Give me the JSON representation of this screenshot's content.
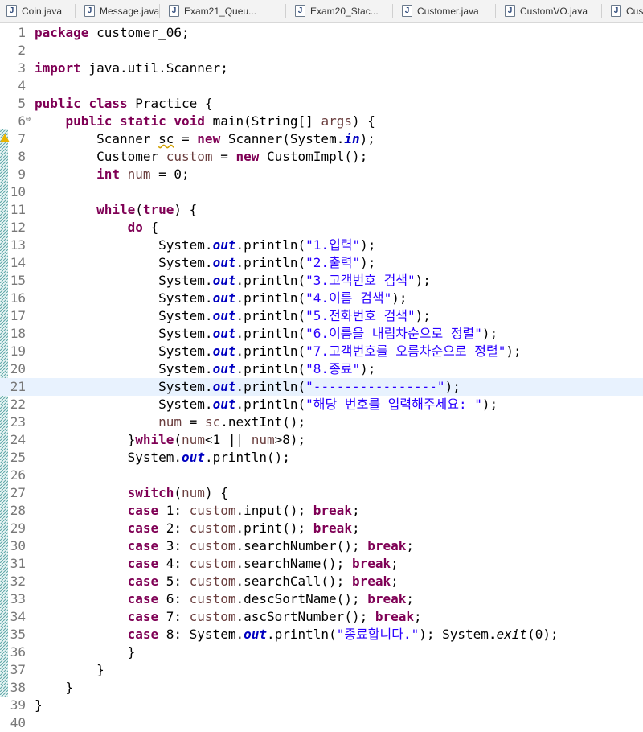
{
  "tabs": [
    "Coin.java",
    "Message.java",
    "Exam21_Queu...",
    "Exam20_Stac...",
    "Customer.java",
    "CustomVO.java",
    "Cust"
  ],
  "line_numbers": [
    "1",
    "2",
    "3",
    "4",
    "5",
    "6",
    "7",
    "8",
    "9",
    "10",
    "11",
    "12",
    "13",
    "14",
    "15",
    "16",
    "17",
    "18",
    "19",
    "20",
    "21",
    "22",
    "23",
    "24",
    "25",
    "26",
    "27",
    "28",
    "29",
    "30",
    "31",
    "32",
    "33",
    "34",
    "35",
    "36",
    "37",
    "38",
    "39",
    "40"
  ],
  "fold_marker": "⊖",
  "highlighted_line": 21,
  "code": [
    [
      [
        "kw",
        "package"
      ],
      [
        "p",
        " customer_06;"
      ]
    ],
    [],
    [
      [
        "kw",
        "import"
      ],
      [
        "p",
        " java.util.Scanner;"
      ]
    ],
    [],
    [
      [
        "kw",
        "public"
      ],
      [
        "p",
        " "
      ],
      [
        "kw",
        "class"
      ],
      [
        "p",
        " Practice {"
      ]
    ],
    [
      [
        "p",
        "    "
      ],
      [
        "kw",
        "public"
      ],
      [
        "p",
        " "
      ],
      [
        "kw",
        "static"
      ],
      [
        "p",
        " "
      ],
      [
        "kw",
        "void"
      ],
      [
        "p",
        " main(String[] "
      ],
      [
        "var",
        "args"
      ],
      [
        "p",
        ") {"
      ]
    ],
    [
      [
        "p",
        "        Scanner "
      ],
      [
        "warn",
        "sc"
      ],
      [
        "p",
        " = "
      ],
      [
        "kw",
        "new"
      ],
      [
        "p",
        " Scanner(System."
      ],
      [
        "fld",
        "in"
      ],
      [
        "p",
        ");"
      ]
    ],
    [
      [
        "p",
        "        Customer "
      ],
      [
        "var",
        "custom"
      ],
      [
        "p",
        " = "
      ],
      [
        "kw",
        "new"
      ],
      [
        "p",
        " CustomImpl();"
      ]
    ],
    [
      [
        "p",
        "        "
      ],
      [
        "kw",
        "int"
      ],
      [
        "p",
        " "
      ],
      [
        "var",
        "num"
      ],
      [
        "p",
        " = 0;"
      ]
    ],
    [],
    [
      [
        "p",
        "        "
      ],
      [
        "kw",
        "while"
      ],
      [
        "p",
        "("
      ],
      [
        "kw",
        "true"
      ],
      [
        "p",
        ") {"
      ]
    ],
    [
      [
        "p",
        "            "
      ],
      [
        "kw",
        "do"
      ],
      [
        "p",
        " {"
      ]
    ],
    [
      [
        "p",
        "                System."
      ],
      [
        "fld",
        "out"
      ],
      [
        "p",
        ".println("
      ],
      [
        "str",
        "\"1.입력\""
      ],
      [
        "p",
        ");"
      ]
    ],
    [
      [
        "p",
        "                System."
      ],
      [
        "fld",
        "out"
      ],
      [
        "p",
        ".println("
      ],
      [
        "str",
        "\"2.출력\""
      ],
      [
        "p",
        ");"
      ]
    ],
    [
      [
        "p",
        "                System."
      ],
      [
        "fld",
        "out"
      ],
      [
        "p",
        ".println("
      ],
      [
        "str",
        "\"3.고객번호 검색\""
      ],
      [
        "p",
        ");"
      ]
    ],
    [
      [
        "p",
        "                System."
      ],
      [
        "fld",
        "out"
      ],
      [
        "p",
        ".println("
      ],
      [
        "str",
        "\"4.이름 검색\""
      ],
      [
        "p",
        ");"
      ]
    ],
    [
      [
        "p",
        "                System."
      ],
      [
        "fld",
        "out"
      ],
      [
        "p",
        ".println("
      ],
      [
        "str",
        "\"5.전화번호 검색\""
      ],
      [
        "p",
        ");"
      ]
    ],
    [
      [
        "p",
        "                System."
      ],
      [
        "fld",
        "out"
      ],
      [
        "p",
        ".println("
      ],
      [
        "str",
        "\"6.이름을 내림차순으로 정렬\""
      ],
      [
        "p",
        ");"
      ]
    ],
    [
      [
        "p",
        "                System."
      ],
      [
        "fld",
        "out"
      ],
      [
        "p",
        ".println("
      ],
      [
        "str",
        "\"7.고객번호를 오름차순으로 정렬\""
      ],
      [
        "p",
        ");"
      ]
    ],
    [
      [
        "p",
        "                System."
      ],
      [
        "fld",
        "out"
      ],
      [
        "p",
        ".println("
      ],
      [
        "str",
        "\"8.종료\""
      ],
      [
        "p",
        ");"
      ]
    ],
    [
      [
        "p",
        "                System."
      ],
      [
        "fld",
        "out"
      ],
      [
        "p",
        ".println("
      ],
      [
        "str",
        "\"----------------\""
      ],
      [
        "p",
        ");"
      ]
    ],
    [
      [
        "p",
        "                System."
      ],
      [
        "fld",
        "out"
      ],
      [
        "p",
        ".println("
      ],
      [
        "str",
        "\"해당 번호를 입력해주세요: \""
      ],
      [
        "p",
        ");"
      ]
    ],
    [
      [
        "p",
        "                "
      ],
      [
        "var",
        "num"
      ],
      [
        "p",
        " = "
      ],
      [
        "var",
        "sc"
      ],
      [
        "p",
        ".nextInt();"
      ]
    ],
    [
      [
        "p",
        "            }"
      ],
      [
        "kw",
        "while"
      ],
      [
        "p",
        "("
      ],
      [
        "var",
        "num"
      ],
      [
        "p",
        "<1 || "
      ],
      [
        "var",
        "num"
      ],
      [
        "p",
        ">8);"
      ]
    ],
    [
      [
        "p",
        "            System."
      ],
      [
        "fld",
        "out"
      ],
      [
        "p",
        ".println();"
      ]
    ],
    [],
    [
      [
        "p",
        "            "
      ],
      [
        "kw",
        "switch"
      ],
      [
        "p",
        "("
      ],
      [
        "var",
        "num"
      ],
      [
        "p",
        ") {"
      ]
    ],
    [
      [
        "p",
        "            "
      ],
      [
        "kw",
        "case"
      ],
      [
        "p",
        " 1: "
      ],
      [
        "var",
        "custom"
      ],
      [
        "p",
        ".input(); "
      ],
      [
        "kw",
        "break"
      ],
      [
        "p",
        ";"
      ]
    ],
    [
      [
        "p",
        "            "
      ],
      [
        "kw",
        "case"
      ],
      [
        "p",
        " 2: "
      ],
      [
        "var",
        "custom"
      ],
      [
        "p",
        ".print(); "
      ],
      [
        "kw",
        "break"
      ],
      [
        "p",
        ";"
      ]
    ],
    [
      [
        "p",
        "            "
      ],
      [
        "kw",
        "case"
      ],
      [
        "p",
        " 3: "
      ],
      [
        "var",
        "custom"
      ],
      [
        "p",
        ".searchNumber(); "
      ],
      [
        "kw",
        "break"
      ],
      [
        "p",
        ";"
      ]
    ],
    [
      [
        "p",
        "            "
      ],
      [
        "kw",
        "case"
      ],
      [
        "p",
        " 4: "
      ],
      [
        "var",
        "custom"
      ],
      [
        "p",
        ".searchName(); "
      ],
      [
        "kw",
        "break"
      ],
      [
        "p",
        ";"
      ]
    ],
    [
      [
        "p",
        "            "
      ],
      [
        "kw",
        "case"
      ],
      [
        "p",
        " 5: "
      ],
      [
        "var",
        "custom"
      ],
      [
        "p",
        ".searchCall(); "
      ],
      [
        "kw",
        "break"
      ],
      [
        "p",
        ";"
      ]
    ],
    [
      [
        "p",
        "            "
      ],
      [
        "kw",
        "case"
      ],
      [
        "p",
        " 6: "
      ],
      [
        "var",
        "custom"
      ],
      [
        "p",
        ".descSortName(); "
      ],
      [
        "kw",
        "break"
      ],
      [
        "p",
        ";"
      ]
    ],
    [
      [
        "p",
        "            "
      ],
      [
        "kw",
        "case"
      ],
      [
        "p",
        " 7: "
      ],
      [
        "var",
        "custom"
      ],
      [
        "p",
        ".ascSortNumber(); "
      ],
      [
        "kw",
        "break"
      ],
      [
        "p",
        ";"
      ]
    ],
    [
      [
        "p",
        "            "
      ],
      [
        "kw",
        "case"
      ],
      [
        "p",
        " 8: System."
      ],
      [
        "fld",
        "out"
      ],
      [
        "p",
        ".println("
      ],
      [
        "str",
        "\"종료합니다.\""
      ],
      [
        "p",
        "); System."
      ],
      [
        "smeth",
        "exit"
      ],
      [
        "p",
        "(0);"
      ]
    ],
    [
      [
        "p",
        "            }"
      ]
    ],
    [
      [
        "p",
        "        }"
      ]
    ],
    [
      [
        "p",
        "    }"
      ]
    ],
    [
      [
        "p",
        "}"
      ]
    ],
    []
  ],
  "colors": {
    "keyword": "#7f0055",
    "string": "#2a00ff",
    "static_field": "#0000c0",
    "variable": "#6a3e3e",
    "line_number": "#787878",
    "current_line": "#e8f2fe",
    "change_ruler": "#5fa8a8"
  }
}
